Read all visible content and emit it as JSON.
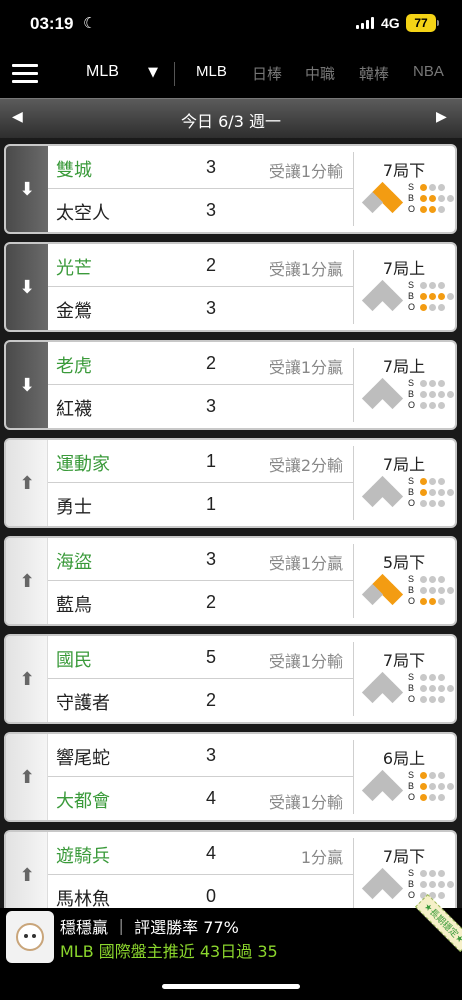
{
  "status_bar": {
    "time": "03:19",
    "network": "4G",
    "battery": "77"
  },
  "nav": {
    "league_select": "MLB",
    "tabs": [
      {
        "label": "MLB",
        "active": true
      },
      {
        "label": "日棒",
        "active": false
      },
      {
        "label": "中職",
        "active": false
      },
      {
        "label": "韓棒",
        "active": false
      },
      {
        "label": "NBA",
        "active": false
      }
    ]
  },
  "date_bar": {
    "title": "今日 6/3 週一"
  },
  "games": [
    {
      "side": "dark",
      "top": {
        "team": "雙城",
        "score": "3",
        "odds": "受讓1分輸",
        "fav": true
      },
      "bottom": {
        "team": "太空人",
        "score": "3",
        "odds": "",
        "fav": false
      },
      "inning": "7局下",
      "bases": [
        true,
        true,
        false
      ],
      "strikes": 1,
      "balls": 2,
      "outs": 2
    },
    {
      "side": "dark",
      "top": {
        "team": "光芒",
        "score": "2",
        "odds": "受讓1分贏",
        "fav": true
      },
      "bottom": {
        "team": "金鶯",
        "score": "3",
        "odds": "",
        "fav": false
      },
      "inning": "7局上",
      "bases": [
        false,
        false,
        false
      ],
      "strikes": 0,
      "balls": 3,
      "outs": 1
    },
    {
      "side": "dark",
      "top": {
        "team": "老虎",
        "score": "2",
        "odds": "受讓1分贏",
        "fav": true
      },
      "bottom": {
        "team": "紅襪",
        "score": "3",
        "odds": "",
        "fav": false
      },
      "inning": "7局上",
      "bases": [
        false,
        false,
        false
      ],
      "strikes": 0,
      "balls": 0,
      "outs": 0
    },
    {
      "side": "light",
      "top": {
        "team": "運動家",
        "score": "1",
        "odds": "受讓2分輸",
        "fav": true
      },
      "bottom": {
        "team": "勇士",
        "score": "1",
        "odds": "",
        "fav": false
      },
      "inning": "7局上",
      "bases": [
        false,
        false,
        false
      ],
      "strikes": 1,
      "balls": 1,
      "outs": 0
    },
    {
      "side": "light",
      "top": {
        "team": "海盜",
        "score": "3",
        "odds": "受讓1分贏",
        "fav": true
      },
      "bottom": {
        "team": "藍鳥",
        "score": "2",
        "odds": "",
        "fav": false
      },
      "inning": "5局下",
      "bases": [
        true,
        true,
        false
      ],
      "strikes": 0,
      "balls": 0,
      "outs": 2
    },
    {
      "side": "light",
      "top": {
        "team": "國民",
        "score": "5",
        "odds": "受讓1分輸",
        "fav": true
      },
      "bottom": {
        "team": "守護者",
        "score": "2",
        "odds": "",
        "fav": false
      },
      "inning": "7局下",
      "bases": [
        false,
        false,
        false
      ],
      "strikes": 0,
      "balls": 0,
      "outs": 0
    },
    {
      "side": "light",
      "top": {
        "team": "響尾蛇",
        "score": "3",
        "odds": "",
        "fav": false
      },
      "bottom": {
        "team": "大都會",
        "score": "4",
        "odds": "受讓1分輸",
        "fav": true
      },
      "inning": "6局上",
      "bases": [
        false,
        false,
        false
      ],
      "strikes": 1,
      "balls": 1,
      "outs": 1
    },
    {
      "side": "light",
      "top": {
        "team": "遊騎兵",
        "score": "4",
        "odds": "1分贏",
        "fav": true
      },
      "bottom": {
        "team": "馬林魚",
        "score": "0",
        "odds": "",
        "fav": false
      },
      "inning": "7局下",
      "bases": [
        false,
        false,
        false
      ],
      "strikes": 0,
      "balls": 0,
      "outs": 0
    }
  ],
  "sbo_labels": [
    "S",
    "B",
    "O"
  ],
  "banner": {
    "line1": "穩穩贏 ｜ 評選勝率 77%",
    "line2": "MLB 國際盤主推近 43日過 35",
    "stamp": "★長期穩定★"
  },
  "colors": {
    "favorite_team": "#3a9a3a",
    "base_on": "#f39c12",
    "base_off": "#bdbdbd",
    "dot_on": "#f39c12",
    "dot_off": "#c8c8c8",
    "banner_highlight": "#8bd62d"
  }
}
